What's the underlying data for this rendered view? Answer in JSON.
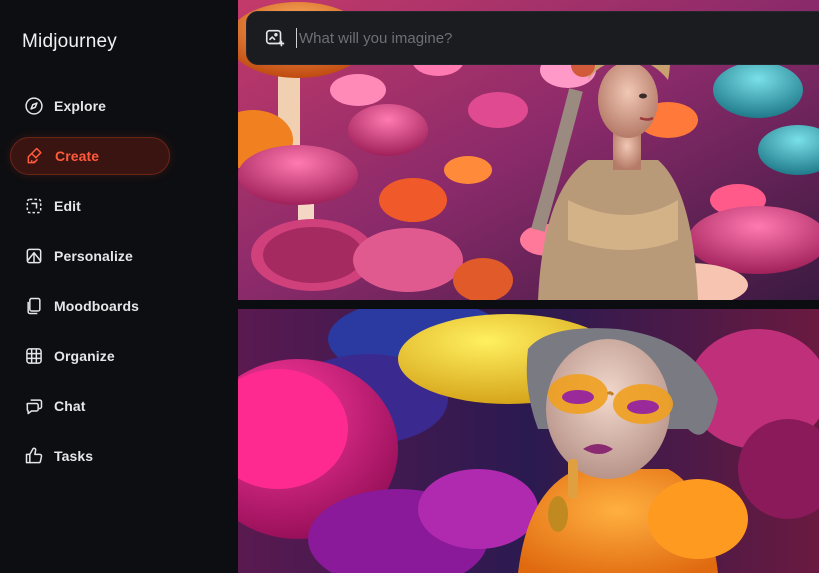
{
  "app": {
    "title": "Midjourney"
  },
  "sidebar": {
    "items": [
      {
        "label": "Explore",
        "icon": "compass-icon",
        "active": false
      },
      {
        "label": "Create",
        "icon": "brush-icon",
        "active": true
      },
      {
        "label": "Edit",
        "icon": "edit-icon",
        "active": false
      },
      {
        "label": "Personalize",
        "icon": "personalize-icon",
        "active": false
      },
      {
        "label": "Moodboards",
        "icon": "moodboards-icon",
        "active": false
      },
      {
        "label": "Organize",
        "icon": "grid-icon",
        "active": false
      },
      {
        "label": "Chat",
        "icon": "chat-icon",
        "active": false
      },
      {
        "label": "Tasks",
        "icon": "thumbs-up-icon",
        "active": false
      }
    ]
  },
  "prompt": {
    "placeholder": "What will you imagine?",
    "value": ""
  },
  "colors": {
    "accent": "#ff5a3c",
    "sidebar_bg": "#0d0e11",
    "search_bg": "#1b1c20"
  },
  "gallery": {
    "images": [
      {
        "subject": "woman in ornate headdress among colorful mushrooms"
      },
      {
        "subject": "woman with orange sunglasses among pink and purple mushrooms"
      }
    ]
  }
}
